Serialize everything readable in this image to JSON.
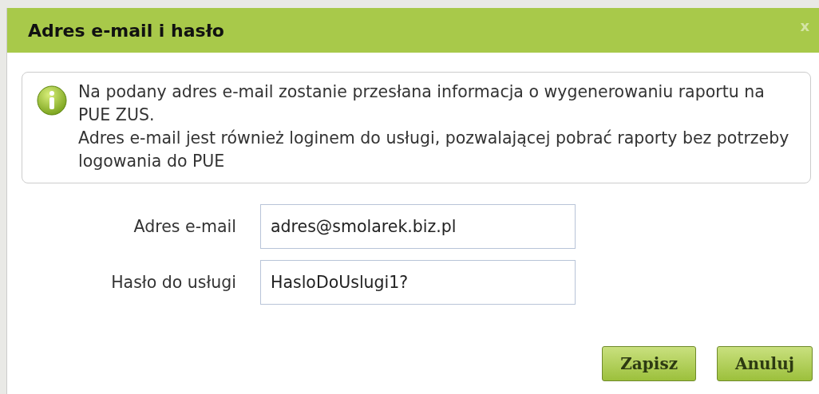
{
  "dialog": {
    "title": "Adres e-mail i hasło",
    "close": "x"
  },
  "info": {
    "paragraphs": [
      "Na podany adres e-mail zostanie przesłana informacja o wygenerowaniu raportu na PUE ZUS.",
      "Adres e-mail jest również loginem do usługi, pozwalającej pobrać raporty bez potrzeby logowania do PUE"
    ]
  },
  "fields": [
    {
      "label": "Adres e-mail",
      "value": "adres@smolarek.biz.pl"
    },
    {
      "label": "Hasło do usługi",
      "value": "HasloDoUslugi1?"
    }
  ],
  "buttons": [
    "Zapisz",
    "Anuluj"
  ]
}
